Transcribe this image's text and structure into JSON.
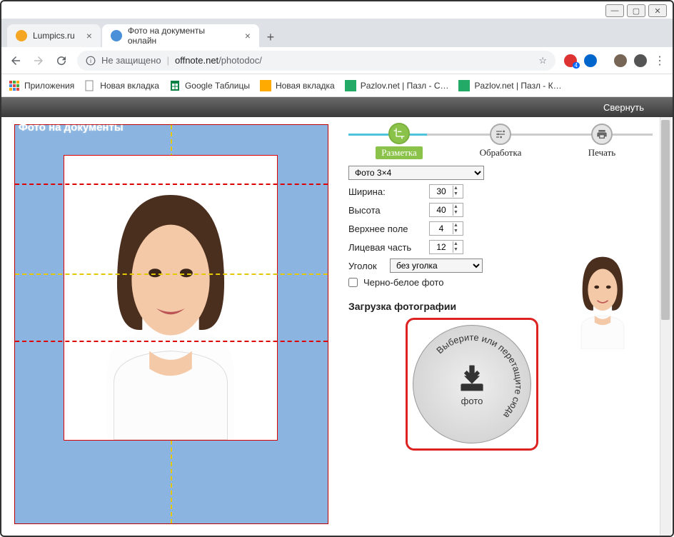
{
  "window": {
    "min": "—",
    "max": "▢",
    "close": "✕"
  },
  "tabs": [
    {
      "title": "Lumpics.ru",
      "icon_color": "#f5a623"
    },
    {
      "title": "Фото на документы онлайн",
      "icon_color": "#4a90d9"
    }
  ],
  "address": {
    "security_label": "Не защищено",
    "host": "offnote.net",
    "path": "/photodoc/"
  },
  "bookmarks": [
    {
      "label": "Приложения",
      "icon": "apps"
    },
    {
      "label": "Новая вкладка",
      "icon": "page"
    },
    {
      "label": "Google Таблицы",
      "icon": "sheets"
    },
    {
      "label": "Новая вкладка",
      "icon": "yellow"
    },
    {
      "label": "Pazlov.net | Пазл - С…",
      "icon": "puzzle"
    },
    {
      "label": "Pazlov.net | Пазл - К…",
      "icon": "puzzle"
    }
  ],
  "app_bar": {
    "collapse": "Свернуть"
  },
  "canvas_title": "Фото на документы",
  "steps": [
    {
      "label": "Разметка",
      "icon": "crop",
      "active": true
    },
    {
      "label": "Обработка",
      "icon": "sliders",
      "active": false
    },
    {
      "label": "Печать",
      "icon": "print",
      "active": false
    }
  ],
  "settings": {
    "format_selected": "Фото 3×4",
    "width_label": "Ширина:",
    "width_value": "30",
    "height_label": "Высота",
    "height_value": "40",
    "top_margin_label": "Верхнее поле",
    "top_margin_value": "4",
    "face_part_label": "Лицевая часть",
    "face_part_value": "12",
    "corner_label": "Уголок",
    "corner_selected": "без уголка",
    "bw_label": "Черно-белое фото",
    "bw_checked": false
  },
  "upload": {
    "section_title": "Загрузка фотографии",
    "curved_text": "Выберите или перетащите сюда",
    "center_word": "фото"
  }
}
